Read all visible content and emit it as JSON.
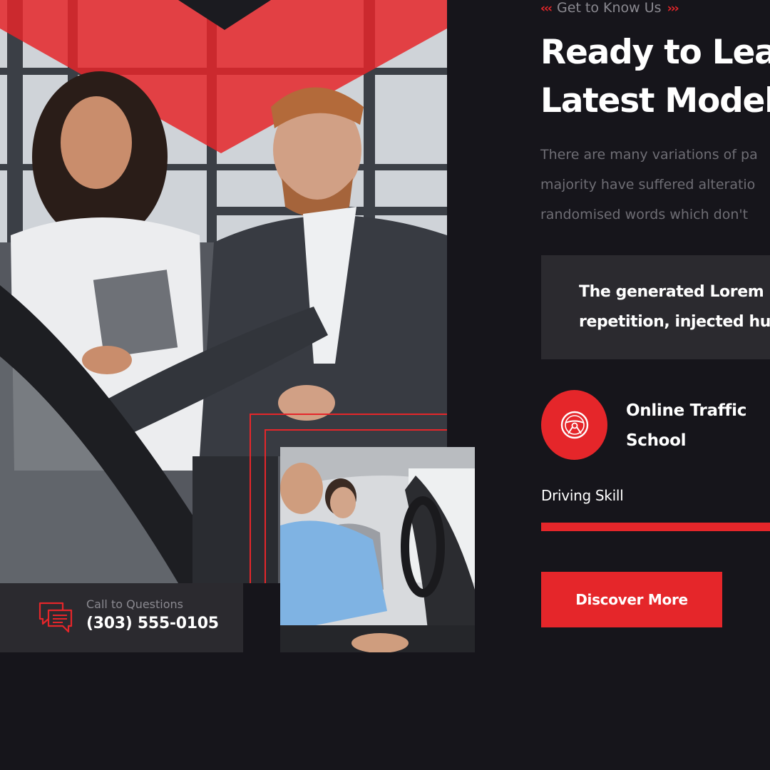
{
  "section": {
    "tagline_left": "‹‹‹",
    "tagline": "Get to Know Us",
    "tagline_right": "›››",
    "heading_line1": "Ready to Learn",
    "heading_line2": "Latest Models",
    "desc_line1": "There are many variations of pa",
    "desc_line2": "majority have suffered alteratio",
    "desc_line3": "randomised words which don't",
    "quote_line1": "The generated Lorem",
    "quote_line2": "repetition, injected hu"
  },
  "feature": {
    "icon": "steering-wheel-icon",
    "title_line1": "Online Traffic",
    "title_line2": "School"
  },
  "skill": {
    "label": "Driving Skill",
    "progress": 1.0
  },
  "cta": {
    "button_label": "Discover More"
  },
  "contact": {
    "icon": "chat-bubbles-icon",
    "label": "Call to Questions",
    "phone": "(303) 555-0105"
  },
  "colors": {
    "accent": "#e5262a",
    "background": "#16151b",
    "panel": "#2b2a2f"
  }
}
